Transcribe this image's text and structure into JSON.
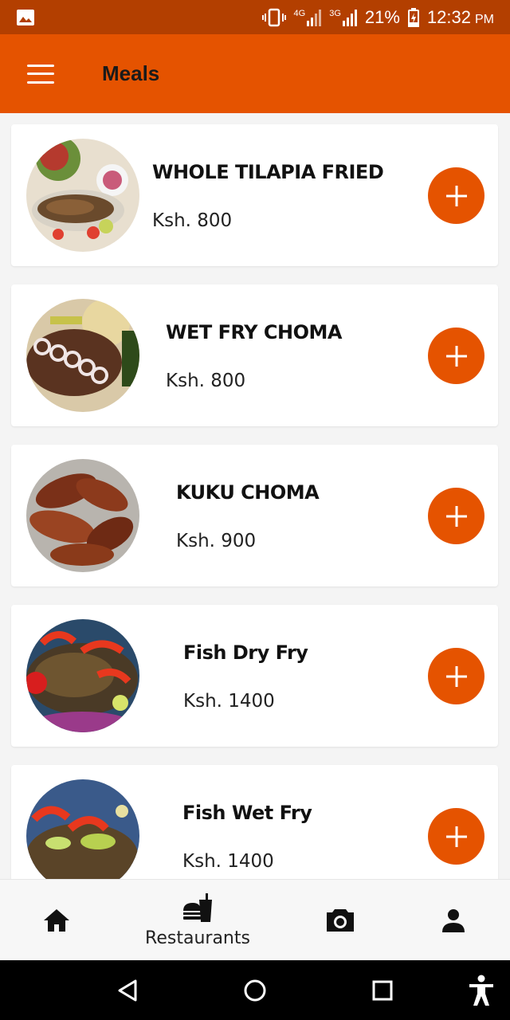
{
  "status_bar": {
    "network_4g": "4G",
    "network_3g": "3G",
    "battery": "21%",
    "time": "12:32",
    "ampm": "PM"
  },
  "app_bar": {
    "title": "Meals"
  },
  "meals": [
    {
      "name": "WHOLE TILAPIA FRIED",
      "price": "Ksh. 800"
    },
    {
      "name": "WET FRY  CHOMA",
      "price": "Ksh. 800"
    },
    {
      "name": "KUKU CHOMA",
      "price": "Ksh. 900"
    },
    {
      "name": "Fish Dry Fry",
      "price": "Ksh. 1400"
    },
    {
      "name": "Fish Wet Fry",
      "price": "Ksh. 1400"
    }
  ],
  "bottom_nav": {
    "home_icon": "home-icon",
    "restaurants_label": "Restaurants",
    "camera_icon": "camera-icon",
    "profile_icon": "person-icon"
  },
  "colors": {
    "status_bar": "#b33f00",
    "primary": "#e55300",
    "background": "#f4f4f4"
  }
}
